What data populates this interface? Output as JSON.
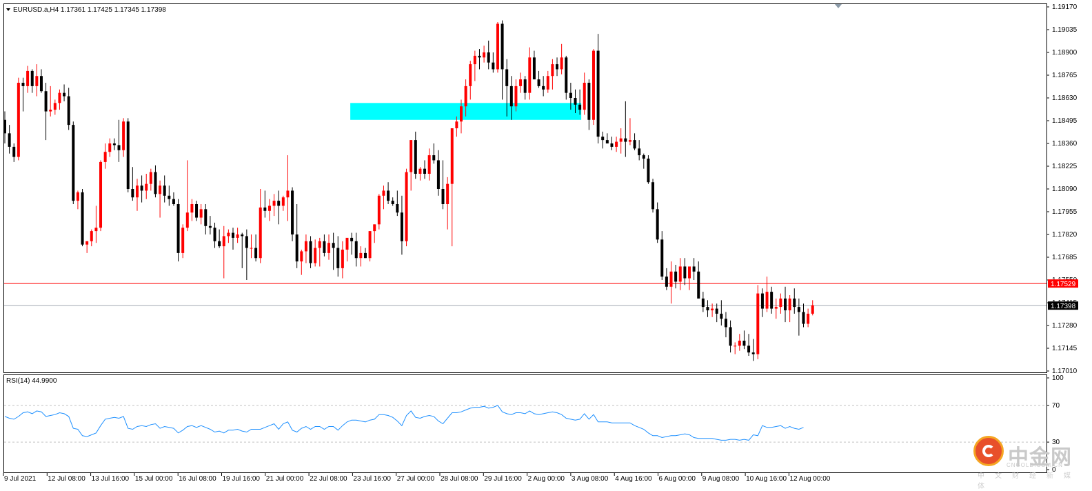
{
  "chart_info": {
    "symbol_header": "EURUSD.a,H4  1.17361 1.17425 1.17345 1.17398",
    "rsi_header": "RSI(14) 44.9900"
  },
  "colors": {
    "bull": "#ff0000",
    "bear": "#000000",
    "zone": "#00ffff",
    "resistance_line": "#ff0000",
    "bid_line": "#a0a8b0",
    "rsi_line": "#1e90ff",
    "grid": "#c0c0c0"
  },
  "price_axis": {
    "ticks": [
      "1.19170",
      "1.19035",
      "1.18900",
      "1.18765",
      "1.18630",
      "1.18495",
      "1.18360",
      "1.18225",
      "1.18090",
      "1.17955",
      "1.17820",
      "1.17685",
      "1.17550",
      "1.17415",
      "1.17280",
      "1.17145",
      "1.17010"
    ],
    "resistance_label": "1.17529",
    "bid_label": "1.17398"
  },
  "rsi_axis": {
    "ticks": [
      "100",
      "70",
      "30",
      "0"
    ]
  },
  "time_axis": {
    "labels": [
      "9 Jul 2021",
      "12 Jul 08:00",
      "13 Jul 16:00",
      "15 Jul 00:00",
      "16 Jul 08:00",
      "19 Jul 16:00",
      "21 Jul 00:00",
      "22 Jul 08:00",
      "23 Jul 16:00",
      "27 Jul 00:00",
      "28 Jul 08:00",
      "29 Jul 16:00",
      "2 Aug 00:00",
      "3 Aug 08:00",
      "4 Aug 16:00",
      "6 Aug 00:00",
      "9 Aug 08:00",
      "10 Aug 16:00",
      "12 Aug 00:00"
    ]
  },
  "watermark": {
    "brand": "中金网",
    "url": "CNGOLD.COM.CN",
    "tagline": "中文财经新媒体"
  },
  "chart_data": {
    "type": "candlestick",
    "symbol": "EURUSD.a",
    "timeframe": "H4",
    "ylim": [
      1.1701,
      1.1917
    ],
    "levels": {
      "resistance": 1.17529,
      "bid": 1.17398
    },
    "zone": {
      "low": 1.185,
      "high": 1.186,
      "from_index": 76,
      "to_index": 126
    },
    "ohlc": [
      [
        1.185,
        1.1855,
        1.1836,
        1.1842
      ],
      [
        1.1842,
        1.1847,
        1.183,
        1.1834
      ],
      [
        1.1834,
        1.1836,
        1.1825,
        1.1828
      ],
      [
        1.1828,
        1.1875,
        1.1826,
        1.1872
      ],
      [
        1.1872,
        1.1875,
        1.1855,
        1.187
      ],
      [
        1.187,
        1.1882,
        1.1866,
        1.1879
      ],
      [
        1.1879,
        1.188,
        1.1866,
        1.187
      ],
      [
        1.187,
        1.1883,
        1.1864,
        1.1876
      ],
      [
        1.1876,
        1.188,
        1.1866,
        1.1867
      ],
      [
        1.1867,
        1.1872,
        1.1838,
        1.1855
      ],
      [
        1.1855,
        1.187,
        1.1852,
        1.1856
      ],
      [
        1.1856,
        1.1862,
        1.1853,
        1.186
      ],
      [
        1.186,
        1.1868,
        1.1856,
        1.1866
      ],
      [
        1.1866,
        1.1871,
        1.1861,
        1.1864
      ],
      [
        1.1864,
        1.1869,
        1.1844,
        1.1847
      ],
      [
        1.1847,
        1.1849,
        1.18,
        1.1802
      ],
      [
        1.1802,
        1.1808,
        1.1797,
        1.1807
      ],
      [
        1.1807,
        1.1809,
        1.1775,
        1.1776
      ],
      [
        1.1776,
        1.1778,
        1.1771,
        1.1778
      ],
      [
        1.1778,
        1.1785,
        1.1775,
        1.1784
      ],
      [
        1.1784,
        1.1799,
        1.1777,
        1.1786
      ],
      [
        1.1786,
        1.1826,
        1.1784,
        1.1825
      ],
      [
        1.1825,
        1.1836,
        1.1821,
        1.1831
      ],
      [
        1.1831,
        1.1839,
        1.1828,
        1.1836
      ],
      [
        1.1836,
        1.1839,
        1.1832,
        1.1835
      ],
      [
        1.1835,
        1.185,
        1.1825,
        1.1832
      ],
      [
        1.1832,
        1.1851,
        1.1828,
        1.1849
      ],
      [
        1.1849,
        1.1851,
        1.1807,
        1.1809
      ],
      [
        1.1809,
        1.1822,
        1.1802,
        1.1804
      ],
      [
        1.1804,
        1.1815,
        1.1796,
        1.1811
      ],
      [
        1.1811,
        1.1817,
        1.1801,
        1.1808
      ],
      [
        1.1808,
        1.1818,
        1.1803,
        1.1812
      ],
      [
        1.1812,
        1.1821,
        1.1808,
        1.1819
      ],
      [
        1.1819,
        1.1823,
        1.1804,
        1.1806
      ],
      [
        1.1806,
        1.1814,
        1.1792,
        1.1811
      ],
      [
        1.1811,
        1.1817,
        1.1801,
        1.1805
      ],
      [
        1.1805,
        1.1811,
        1.1799,
        1.1803
      ],
      [
        1.1803,
        1.1807,
        1.1799,
        1.18
      ],
      [
        1.18,
        1.1803,
        1.1766,
        1.1771
      ],
      [
        1.1771,
        1.1788,
        1.1768,
        1.1786
      ],
      [
        1.1786,
        1.1826,
        1.1784,
        1.1795
      ],
      [
        1.1795,
        1.1803,
        1.179,
        1.18
      ],
      [
        1.18,
        1.1802,
        1.179,
        1.1792
      ],
      [
        1.1792,
        1.18,
        1.1788,
        1.1797
      ],
      [
        1.1797,
        1.18,
        1.1782,
        1.1787
      ],
      [
        1.1787,
        1.1793,
        1.1782,
        1.1786
      ],
      [
        1.1786,
        1.1789,
        1.1774,
        1.1778
      ],
      [
        1.1778,
        1.1785,
        1.1774,
        1.1775
      ],
      [
        1.1775,
        1.1787,
        1.1756,
        1.1781
      ],
      [
        1.1781,
        1.1785,
        1.1777,
        1.1783
      ],
      [
        1.1783,
        1.1786,
        1.1773,
        1.178
      ],
      [
        1.178,
        1.1786,
        1.1777,
        1.1782
      ],
      [
        1.1782,
        1.1783,
        1.1762,
        1.1781
      ],
      [
        1.1781,
        1.1785,
        1.1755,
        1.1774
      ],
      [
        1.1774,
        1.1782,
        1.1768,
        1.1774
      ],
      [
        1.1774,
        1.1782,
        1.1766,
        1.1768
      ],
      [
        1.1768,
        1.1809,
        1.1765,
        1.1798
      ],
      [
        1.1798,
        1.1808,
        1.1792,
        1.1796
      ],
      [
        1.1796,
        1.1803,
        1.179,
        1.1799
      ],
      [
        1.1799,
        1.1806,
        1.1793,
        1.1802
      ],
      [
        1.1802,
        1.1808,
        1.1788,
        1.1799
      ],
      [
        1.1799,
        1.1805,
        1.1796,
        1.1804
      ],
      [
        1.1804,
        1.1829,
        1.179,
        1.1808
      ],
      [
        1.1808,
        1.181,
        1.1778,
        1.1782
      ],
      [
        1.1782,
        1.18,
        1.1762,
        1.1766
      ],
      [
        1.1766,
        1.1773,
        1.1758,
        1.1772
      ],
      [
        1.1772,
        1.1782,
        1.1765,
        1.1778
      ],
      [
        1.1778,
        1.1781,
        1.1762,
        1.1765
      ],
      [
        1.1765,
        1.1779,
        1.1763,
        1.1774
      ],
      [
        1.1774,
        1.178,
        1.1763,
        1.1778
      ],
      [
        1.1778,
        1.1782,
        1.1769,
        1.1771
      ],
      [
        1.1771,
        1.1782,
        1.1767,
        1.1777
      ],
      [
        1.1777,
        1.1783,
        1.1761,
        1.1774
      ],
      [
        1.1774,
        1.1781,
        1.1757,
        1.1762
      ],
      [
        1.1762,
        1.1778,
        1.1756,
        1.1773
      ],
      [
        1.1773,
        1.1779,
        1.1766,
        1.178
      ],
      [
        1.178,
        1.1783,
        1.177,
        1.1778
      ],
      [
        1.1778,
        1.1783,
        1.1763,
        1.1768
      ],
      [
        1.1768,
        1.1775,
        1.1763,
        1.1771
      ],
      [
        1.1771,
        1.1774,
        1.1768,
        1.1768
      ],
      [
        1.1768,
        1.1784,
        1.1766,
        1.1784
      ],
      [
        1.1784,
        1.1788,
        1.1777,
        1.1788
      ],
      [
        1.1788,
        1.1806,
        1.1785,
        1.1805
      ],
      [
        1.1805,
        1.1811,
        1.1797,
        1.1808
      ],
      [
        1.1808,
        1.1813,
        1.18,
        1.1802
      ],
      [
        1.1802,
        1.1804,
        1.1799,
        1.18
      ],
      [
        1.18,
        1.1808,
        1.1793,
        1.1795
      ],
      [
        1.1795,
        1.1805,
        1.177,
        1.1778
      ],
      [
        1.1778,
        1.1821,
        1.1775,
        1.1819
      ],
      [
        1.1819,
        1.1838,
        1.1808,
        1.1838
      ],
      [
        1.1838,
        1.1843,
        1.1815,
        1.1818
      ],
      [
        1.1818,
        1.1822,
        1.1814,
        1.1821
      ],
      [
        1.1821,
        1.1826,
        1.1815,
        1.1818
      ],
      [
        1.1818,
        1.1833,
        1.1814,
        1.1829
      ],
      [
        1.1829,
        1.1836,
        1.1824,
        1.1826
      ],
      [
        1.1826,
        1.1832,
        1.1805,
        1.1809
      ],
      [
        1.1809,
        1.1826,
        1.1797,
        1.18
      ],
      [
        1.18,
        1.1816,
        1.1785,
        1.1812
      ],
      [
        1.1812,
        1.1843,
        1.1775,
        1.1845
      ],
      [
        1.1845,
        1.1852,
        1.184,
        1.1849
      ],
      [
        1.1849,
        1.1862,
        1.1842,
        1.1858
      ],
      [
        1.1858,
        1.1874,
        1.1852,
        1.187
      ],
      [
        1.187,
        1.1885,
        1.1862,
        1.1883
      ],
      [
        1.1883,
        1.1891,
        1.1873,
        1.1888
      ],
      [
        1.1888,
        1.1892,
        1.188,
        1.1887
      ],
      [
        1.1887,
        1.1894,
        1.1884,
        1.189
      ],
      [
        1.189,
        1.1897,
        1.188,
        1.1884
      ],
      [
        1.1884,
        1.189,
        1.1878,
        1.188
      ],
      [
        1.188,
        1.1908,
        1.1878,
        1.1907
      ],
      [
        1.1907,
        1.1909,
        1.1862,
        1.188
      ],
      [
        1.188,
        1.1886,
        1.1852,
        1.187
      ],
      [
        1.187,
        1.1876,
        1.185,
        1.1858
      ],
      [
        1.1858,
        1.1874,
        1.1855,
        1.187
      ],
      [
        1.187,
        1.1878,
        1.1866,
        1.1874
      ],
      [
        1.1874,
        1.1876,
        1.1862,
        1.1866
      ],
      [
        1.1866,
        1.1893,
        1.1862,
        1.1887
      ],
      [
        1.1887,
        1.1891,
        1.1876,
        1.1874
      ],
      [
        1.1874,
        1.1879,
        1.1869,
        1.187
      ],
      [
        1.187,
        1.1876,
        1.1864,
        1.1868
      ],
      [
        1.1868,
        1.1879,
        1.1866,
        1.1876
      ],
      [
        1.1876,
        1.1886,
        1.1868,
        1.1883
      ],
      [
        1.1883,
        1.1887,
        1.1876,
        1.188
      ],
      [
        1.188,
        1.1895,
        1.1877,
        1.1887
      ],
      [
        1.1887,
        1.1888,
        1.1862,
        1.1866
      ],
      [
        1.1866,
        1.1872,
        1.1856,
        1.1863
      ],
      [
        1.1863,
        1.1868,
        1.1854,
        1.1859
      ],
      [
        1.1859,
        1.1868,
        1.1853,
        1.1856
      ],
      [
        1.1856,
        1.1878,
        1.1853,
        1.1872
      ],
      [
        1.1872,
        1.1874,
        1.1844,
        1.185
      ],
      [
        1.185,
        1.1892,
        1.1847,
        1.1891
      ],
      [
        1.1891,
        1.1901,
        1.1836,
        1.184
      ],
      [
        1.184,
        1.1843,
        1.1833,
        1.1838
      ],
      [
        1.1838,
        1.1842,
        1.1836,
        1.1836
      ],
      [
        1.1836,
        1.184,
        1.1832,
        1.1834
      ],
      [
        1.1834,
        1.184,
        1.1831,
        1.1837
      ],
      [
        1.1837,
        1.1845,
        1.183,
        1.1839
      ],
      [
        1.1839,
        1.1861,
        1.1828,
        1.1837
      ],
      [
        1.1837,
        1.1851,
        1.1835,
        1.1838
      ],
      [
        1.1838,
        1.1842,
        1.1832,
        1.1833
      ],
      [
        1.1833,
        1.1838,
        1.1826,
        1.1829
      ],
      [
        1.1829,
        1.183,
        1.1821,
        1.1827
      ],
      [
        1.1827,
        1.1829,
        1.1812,
        1.1813
      ],
      [
        1.1813,
        1.1815,
        1.1795,
        1.1797
      ],
      [
        1.1797,
        1.1801,
        1.1777,
        1.1779
      ],
      [
        1.1779,
        1.1784,
        1.1755,
        1.1757
      ],
      [
        1.1757,
        1.1762,
        1.1749,
        1.1751
      ],
      [
        1.1751,
        1.1766,
        1.1741,
        1.176
      ],
      [
        1.176,
        1.1764,
        1.175,
        1.1754
      ],
      [
        1.1754,
        1.1768,
        1.1749,
        1.1763
      ],
      [
        1.1763,
        1.1768,
        1.1752,
        1.1756
      ],
      [
        1.1756,
        1.1763,
        1.1749,
        1.1763
      ],
      [
        1.1763,
        1.1768,
        1.1755,
        1.176
      ],
      [
        1.176,
        1.1766,
        1.1745,
        1.1744
      ],
      [
        1.1744,
        1.1748,
        1.1736,
        1.1739
      ],
      [
        1.1739,
        1.1743,
        1.1733,
        1.1737
      ],
      [
        1.1737,
        1.1741,
        1.1733,
        1.1738
      ],
      [
        1.1738,
        1.1741,
        1.173,
        1.1735
      ],
      [
        1.1735,
        1.1743,
        1.1728,
        1.1732
      ],
      [
        1.1732,
        1.1736,
        1.1721,
        1.1727
      ],
      [
        1.1727,
        1.1731,
        1.1712,
        1.1716
      ],
      [
        1.1716,
        1.1718,
        1.1711,
        1.1716
      ],
      [
        1.1716,
        1.1723,
        1.1713,
        1.1719
      ],
      [
        1.1719,
        1.1725,
        1.1714,
        1.1716
      ],
      [
        1.1716,
        1.1723,
        1.171,
        1.1712
      ],
      [
        1.1712,
        1.172,
        1.1707,
        1.1711
      ],
      [
        1.1711,
        1.1752,
        1.1708,
        1.1747
      ],
      [
        1.1747,
        1.175,
        1.1733,
        1.1738
      ],
      [
        1.1738,
        1.1757,
        1.1736,
        1.1748
      ],
      [
        1.1748,
        1.1751,
        1.1735,
        1.1738
      ],
      [
        1.1738,
        1.1744,
        1.1732,
        1.1739
      ],
      [
        1.1739,
        1.1747,
        1.1735,
        1.1744
      ],
      [
        1.1744,
        1.1751,
        1.173,
        1.1737
      ],
      [
        1.1737,
        1.1746,
        1.173,
        1.1744
      ],
      [
        1.1744,
        1.175,
        1.1735,
        1.1739
      ],
      [
        1.1739,
        1.1744,
        1.1722,
        1.1736
      ],
      [
        1.1736,
        1.1741,
        1.1727,
        1.1729
      ],
      [
        1.1729,
        1.1738,
        1.1727,
        1.1735
      ],
      [
        1.1735,
        1.1743,
        1.1734,
        1.174
      ]
    ],
    "rsi": [
      58,
      56,
      55,
      58,
      62,
      63,
      61,
      64,
      63,
      58,
      59,
      60,
      62,
      61,
      58,
      45,
      44,
      37,
      36,
      38,
      40,
      48,
      55,
      56,
      57,
      56,
      58,
      45,
      44,
      47,
      48,
      47,
      49,
      50,
      45,
      47,
      46,
      45,
      40,
      43,
      47,
      48,
      46,
      48,
      46,
      44,
      41,
      42,
      40,
      43,
      43,
      44,
      42,
      41,
      44,
      44,
      44,
      46,
      48,
      50,
      44,
      50,
      52,
      43,
      41,
      45,
      47,
      44,
      47,
      47,
      44,
      47,
      47,
      43,
      48,
      52,
      54,
      54,
      53,
      52,
      54,
      55,
      60,
      60,
      59,
      57,
      53,
      48,
      59,
      64,
      57,
      56,
      58,
      59,
      58,
      53,
      50,
      56,
      62,
      62,
      63,
      65,
      67,
      68,
      68,
      69,
      67,
      68,
      70,
      63,
      61,
      60,
      62,
      62,
      61,
      64,
      61,
      60,
      61,
      62,
      63,
      62,
      60,
      56,
      55,
      54,
      55,
      61,
      55,
      60,
      52,
      52,
      52,
      51,
      51,
      51,
      51,
      51,
      48,
      46,
      44,
      40,
      37,
      37,
      35,
      36,
      37,
      37,
      38,
      39,
      38,
      35,
      34,
      34,
      34,
      34,
      33,
      32,
      32,
      33,
      33,
      32,
      33,
      32,
      38,
      37,
      48,
      46,
      46,
      47,
      48,
      45,
      47,
      45,
      44,
      46
    ]
  }
}
